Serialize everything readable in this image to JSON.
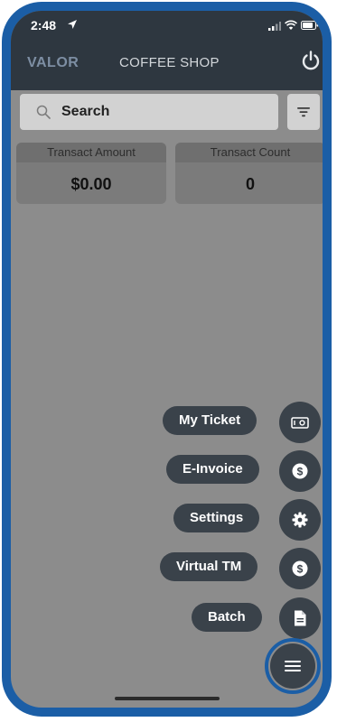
{
  "status_bar": {
    "time": "2:48",
    "location_icon": "location-arrow-icon",
    "signal_icon": "cellular-signal-icon",
    "wifi_icon": "wifi-icon",
    "battery_icon": "battery-icon"
  },
  "header": {
    "brand": "VALOR",
    "shop_name": "COFFEE SHOP",
    "power_icon": "power-icon"
  },
  "search": {
    "label": "Search",
    "search_icon": "search-icon",
    "filter_icon": "filter-icon"
  },
  "summary": {
    "amount_label": "Transact Amount",
    "amount_value": "$0.00",
    "count_label": "Transact Count",
    "count_value": "0"
  },
  "fab_menu": {
    "items": [
      {
        "label": "My Ticket",
        "icon": "ticket-icon"
      },
      {
        "label": "E-Invoice",
        "icon": "dollar-circle-icon"
      },
      {
        "label": "Settings",
        "icon": "gear-icon"
      },
      {
        "label": "Virtual TM",
        "icon": "dollar-circle-icon"
      },
      {
        "label": "Batch",
        "icon": "document-icon"
      }
    ],
    "toggle_icon": "menu-icon"
  },
  "colors": {
    "frame": "#1b5ea6",
    "appbar": "#2e3740",
    "overlay": "#8c8c8c",
    "fab": "#3a424a"
  }
}
